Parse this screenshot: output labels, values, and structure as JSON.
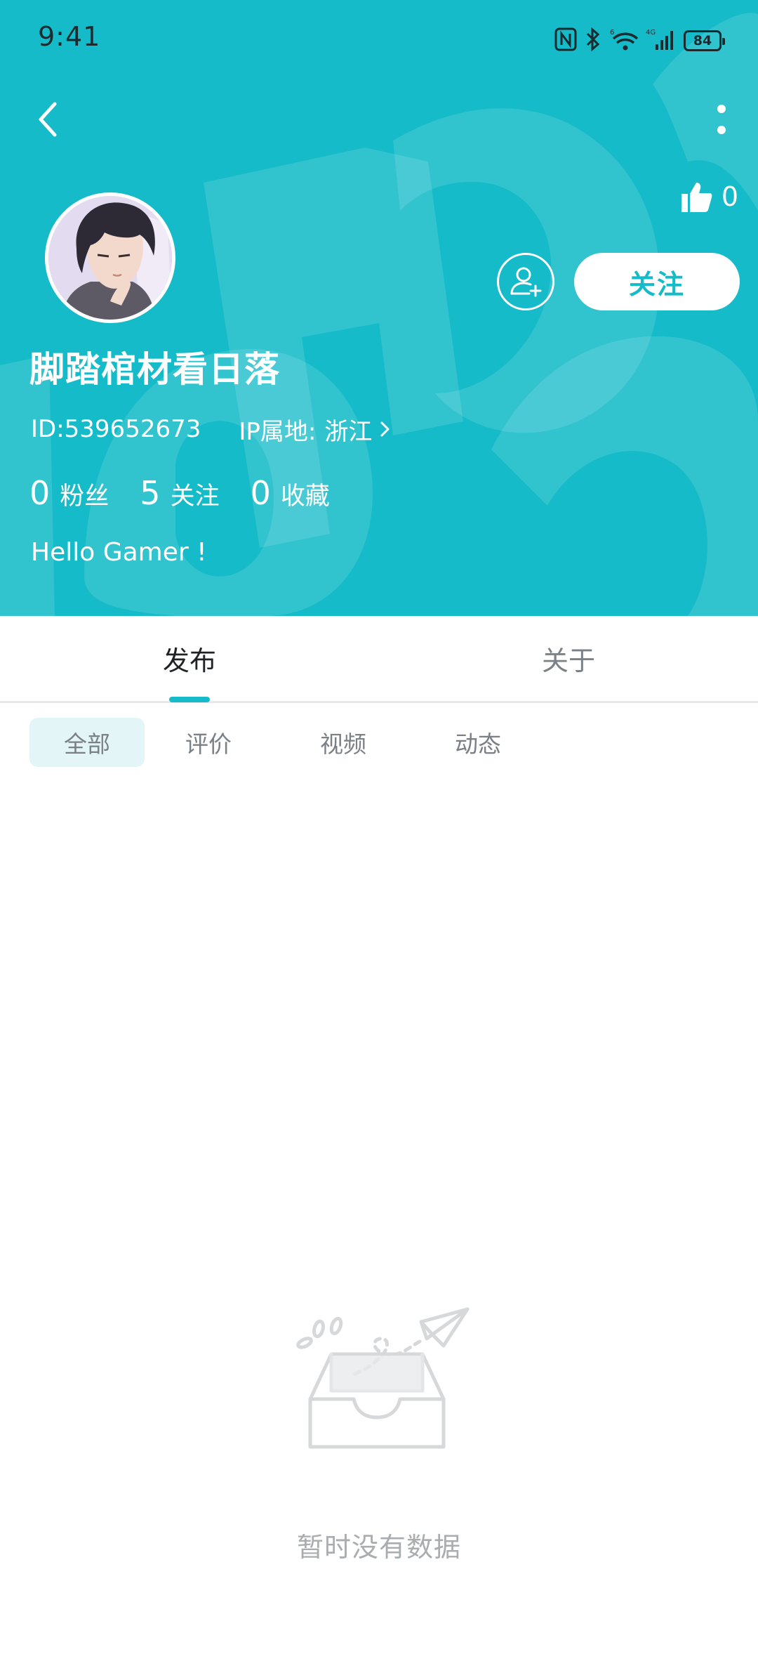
{
  "status_bar": {
    "time": "9:41",
    "battery": "84",
    "icons": [
      "nfc-icon",
      "bluetooth-icon",
      "wifi-icon",
      "4g-signal-icon",
      "battery-icon"
    ]
  },
  "header": {
    "background_color": "#15bbc8",
    "like_count": "0",
    "follow_label": "关注"
  },
  "profile": {
    "name": "脚踏棺材看日落",
    "id": "ID:539652673",
    "ip_label": "IP属地:",
    "ip_value": "浙江",
    "stats": [
      {
        "num": "0",
        "label": "粉丝"
      },
      {
        "num": "5",
        "label": "关注"
      },
      {
        "num": "0",
        "label": "收藏"
      }
    ],
    "bio": "Hello Gamer !"
  },
  "tabs": [
    {
      "label": "发布",
      "active": true
    },
    {
      "label": "关于",
      "active": false
    }
  ],
  "filters": [
    {
      "label": "全部",
      "active": true
    },
    {
      "label": "评价",
      "active": false
    },
    {
      "label": "视频",
      "active": false
    },
    {
      "label": "动态",
      "active": false
    }
  ],
  "empty_state": {
    "text": "暂时没有数据"
  }
}
